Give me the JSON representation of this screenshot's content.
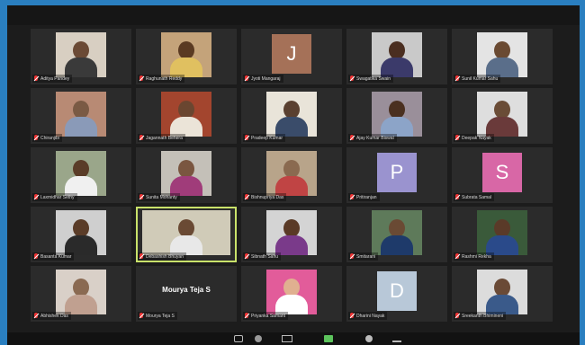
{
  "meeting": {
    "participants": [
      {
        "name": "Aditya Pandey",
        "kind": "video",
        "bg": "#d8cfc2",
        "skin": "#6b4a35",
        "shirt": "#3a3a3a"
      },
      {
        "name": "Raghunath Reddy",
        "kind": "video",
        "bg": "#c4a37a",
        "skin": "#5a3a22",
        "shirt": "#e0c060"
      },
      {
        "name": "Jyoti Mangaraj",
        "kind": "avatar",
        "initial": "J",
        "color": "#a57158"
      },
      {
        "name": "Swagatika Swain",
        "kind": "video",
        "bg": "#c9c9c9",
        "skin": "#4a2e20",
        "shirt": "#3b3a6a"
      },
      {
        "name": "Sunil Kumar Sahu",
        "kind": "video",
        "bg": "#e4e4e4",
        "skin": "#6a4a32",
        "shirt": "#5a6e8a"
      },
      {
        "name": "Chiranjibi",
        "kind": "video",
        "bg": "#b88a74",
        "skin": "#7a5a44",
        "shirt": "#8a9ab8"
      },
      {
        "name": "Jagannath Behera",
        "kind": "video",
        "bg": "#a3452e",
        "skin": "#6a4630",
        "shirt": "#ebe4d8"
      },
      {
        "name": "Pradeep Kumar",
        "kind": "video",
        "bg": "#e9e4d9",
        "skin": "#5a4030",
        "shirt": "#3a4c6a"
      },
      {
        "name": "Ajay Kumar Biswal",
        "kind": "video",
        "bg": "#9a8f9a",
        "skin": "#4a3020",
        "shirt": "#8ca4c8"
      },
      {
        "name": "Deepak Nayak",
        "kind": "video",
        "bg": "#dedede",
        "skin": "#6a4c36",
        "shirt": "#6a3a3a"
      },
      {
        "name": "Laxmidhar Sethy",
        "kind": "video",
        "bg": "#9aa68a",
        "skin": "#5a3c28",
        "shirt": "#f0f0f0"
      },
      {
        "name": "Sunita Mohanty",
        "kind": "video",
        "bg": "#c4c0b8",
        "skin": "#7a5640",
        "shirt": "#a03c7a"
      },
      {
        "name": "Bishnupriya Das",
        "kind": "video",
        "bg": "#b8a48a",
        "skin": "#8a6a50",
        "shirt": "#c04444"
      },
      {
        "name": "Pritiranjan",
        "kind": "avatar",
        "initial": "P",
        "color": "#9a93cf"
      },
      {
        "name": "Subrata Samal",
        "kind": "avatar",
        "initial": "S",
        "color": "#d867a6"
      },
      {
        "name": "Basanta Kumar",
        "kind": "video",
        "bg": "#cfcfcf",
        "skin": "#5a3c28",
        "shirt": "#2a2a2a"
      },
      {
        "name": "Debashish Bhuyan",
        "kind": "video",
        "bg": "#d0cbb8",
        "skin": "#6a4a34",
        "shirt": "#e8e8e8",
        "wide": true,
        "speaking": true
      },
      {
        "name": "Sibnath Sahu",
        "kind": "video",
        "bg": "#d4d4d4",
        "skin": "#5a3a26",
        "shirt": "#7a3a8a"
      },
      {
        "name": "Smitarani",
        "kind": "video",
        "bg": "#5e7a5a",
        "skin": "#6a4a34",
        "shirt": "#1e3a6a"
      },
      {
        "name": "Rashmi Rekha",
        "kind": "video",
        "bg": "#3a5a3a",
        "skin": "#5a3a28",
        "shirt": "#2a4a8a"
      },
      {
        "name": "Abhishek Das",
        "kind": "video",
        "bg": "#d9d0c8",
        "skin": "#8a6a52",
        "shirt": "#c0a090"
      },
      {
        "name": "Mourya Teja S",
        "kind": "name"
      },
      {
        "name": "Priyanka Samant",
        "kind": "video",
        "bg": "#e25c9a",
        "skin": "#e0b090",
        "shirt": "#ffffff"
      },
      {
        "name": "Dharini Nayak",
        "kind": "avatar",
        "initial": "D",
        "color": "#b8c8d8"
      },
      {
        "name": "Sreekanth Bhimineni",
        "kind": "video",
        "bg": "#dcdcdc",
        "skin": "#6a4a36",
        "shirt": "#3a5a8a"
      }
    ]
  },
  "toolbar": {
    "icons": [
      "mute-icon",
      "video-icon",
      "participants-icon",
      "share-screen-icon",
      "record-icon",
      "reactions-icon"
    ]
  }
}
